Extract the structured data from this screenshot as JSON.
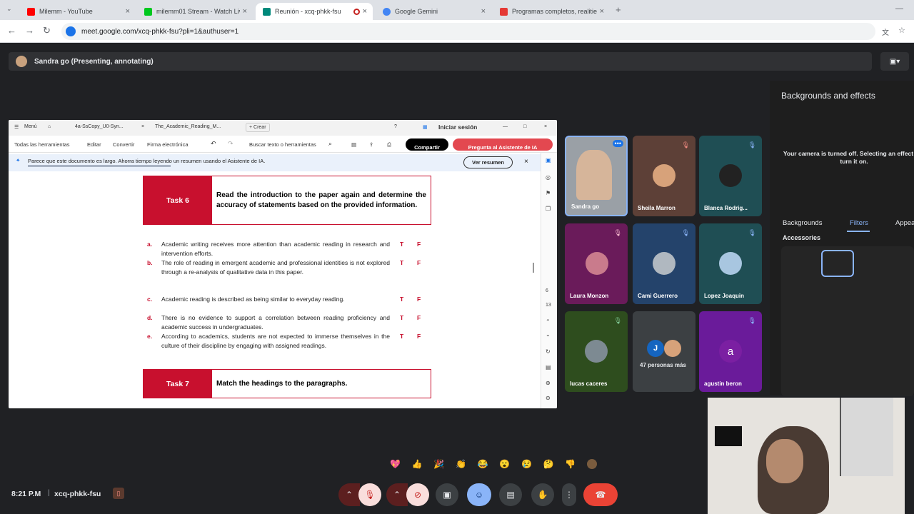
{
  "browser": {
    "tabs": [
      {
        "label": "Milemm - YouTube",
        "color": "#ff0000"
      },
      {
        "label": "milemm01 Stream - Watch Live",
        "color": "#00c81e"
      },
      {
        "label": "Reunión - xcq-phkk-fsu",
        "color": "#00897b",
        "active": true
      },
      {
        "label": "Google Gemini",
        "color": "#4285f4"
      },
      {
        "label": "Programas completos, realities",
        "color": "#e53935"
      }
    ],
    "new_tab": "+",
    "url": "meet.google.com/xcq-phkk-fsu?pli=1&authuser=1",
    "back_icon": "arrow-left-icon",
    "forward_icon": "arrow-right-icon",
    "reload_icon": "reload-icon"
  },
  "presenter": {
    "label": "Sandra go (Presenting, annotating)",
    "control_icon": "present-icon"
  },
  "doc": {
    "top": {
      "menu": "Menú",
      "tab1": "4a-SsCopy_U0-Syn...",
      "tab2": "The_Academic_Reading_M...",
      "create": "+ Crear",
      "signin": "Iniciar sesión"
    },
    "toolbar": {
      "all_tools": "Todas las herramientas",
      "edit": "Editar",
      "convert": "Convertir",
      "esign": "Firma electrónica",
      "search": "Buscar texto o herramientas",
      "share": "Compartir",
      "ask_ai": "Pregunta al Asistente de IA"
    },
    "notice": {
      "text": "Parece que este documento es largo. Ahorra tiempo leyendo un resumen usando el Asistente de IA.",
      "button": "Ver resumen"
    },
    "task6": {
      "label": "Task 6",
      "text": "Read the introduction to the paper again and determine the accuracy of statements based on the provided information."
    },
    "statements": [
      {
        "letter": "a.",
        "text": "Academic writing receives more attention than academic reading in research and intervention efforts.",
        "t": "T",
        "f": "F"
      },
      {
        "letter": "b.",
        "text": "The role of reading in emergent academic and professional identities is not explored through a re-analysis of qualitative data in this paper.",
        "t": "T",
        "f": "F"
      },
      {
        "letter": "c.",
        "text": "Academic reading is described as being similar to everyday reading.",
        "t": "T",
        "f": "F"
      },
      {
        "letter": "d.",
        "text": "There is no evidence to support a correlation between reading proficiency and academic success in undergraduates.",
        "t": "T",
        "f": "F"
      },
      {
        "letter": "e.",
        "text": "According to academics, students are not expected to immerse themselves in the culture of their discipline by engaging with assigned readings.",
        "t": "T",
        "f": "F"
      }
    ],
    "task7": {
      "label": "Task 7",
      "text": "Match the headings to the paragraphs."
    },
    "page_numbers": [
      "6",
      "13"
    ]
  },
  "participants": [
    {
      "name": "Sandra go",
      "bg": "#9aa0a6",
      "face": "#d6b59a",
      "muted": false
    },
    {
      "name": "Sheila Marron",
      "bg": "#5d4037",
      "face": "#d7a27a",
      "muted": true
    },
    {
      "name": "Blanca Rodrig...",
      "bg": "#1f4e54",
      "face": "#222222",
      "muted": true
    },
    {
      "name": "Laura Monzon",
      "bg": "#6a1b5a",
      "face": "#c97b8c",
      "muted": true
    },
    {
      "name": "Cami Guerrero",
      "bg": "#24436b",
      "face": "#b0b8c0",
      "muted": true
    },
    {
      "name": "Lopez Joaquin",
      "bg": "#1f4e54",
      "face": "#a8c6e0",
      "muted": true
    },
    {
      "name": "lucas caceres",
      "bg": "#2e4d1e",
      "face": "#7d8a92",
      "muted": false
    },
    {
      "name": "47 personas más",
      "bg": "#3c4043",
      "face": "#1565c0",
      "muted": false
    },
    {
      "name": "agustin beron",
      "bg": "#6a1b9a",
      "face": "#7b1fa2",
      "muted": true
    }
  ],
  "more_avatar_letter": "J",
  "agustin_letter": "a",
  "effects": {
    "title": "Backgrounds and effects",
    "camera_off": "Your camera is turned off. Selecting an effect will turn it on.",
    "tabs": [
      "Backgrounds",
      "Filters",
      "Appearance"
    ],
    "section": "Accessories",
    "accent": "#8ab4f8"
  },
  "footer": {
    "time": "8:21 P.M",
    "meeting_code": "xcq-phkk-fsu"
  },
  "reactions": [
    "💖",
    "👍",
    "🎉",
    "👏",
    "😂",
    "😮",
    "😢",
    "🤔",
    "👎"
  ],
  "controls": {
    "leave_color": "#ea4335",
    "muted_color": "#f9dedc"
  }
}
